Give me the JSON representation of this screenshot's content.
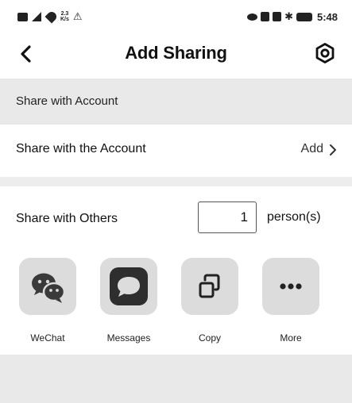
{
  "status_bar": {
    "data_rate_top": "2.3",
    "data_rate_bottom": "K/s",
    "time": "5:48"
  },
  "header": {
    "title": "Add Sharing",
    "back_icon": "chevron-left-icon",
    "settings_icon": "hexagon-gear-icon"
  },
  "account_section": {
    "header": "Share with Account",
    "row_label": "Share with the Account",
    "action_label": "Add"
  },
  "others_section": {
    "label": "Share with Others",
    "count_value": "1",
    "unit": "person(s)"
  },
  "share_targets": [
    {
      "label": "WeChat",
      "icon": "wechat-icon"
    },
    {
      "label": "Messages",
      "icon": "message-bubble-icon"
    },
    {
      "label": "Copy",
      "icon": "copy-icon"
    },
    {
      "label": "More",
      "icon": "more-dots-icon"
    }
  ],
  "colors": {
    "section_background": "#e9e9e9",
    "tile_background": "#dcdcdc",
    "text_primary": "#111111"
  }
}
